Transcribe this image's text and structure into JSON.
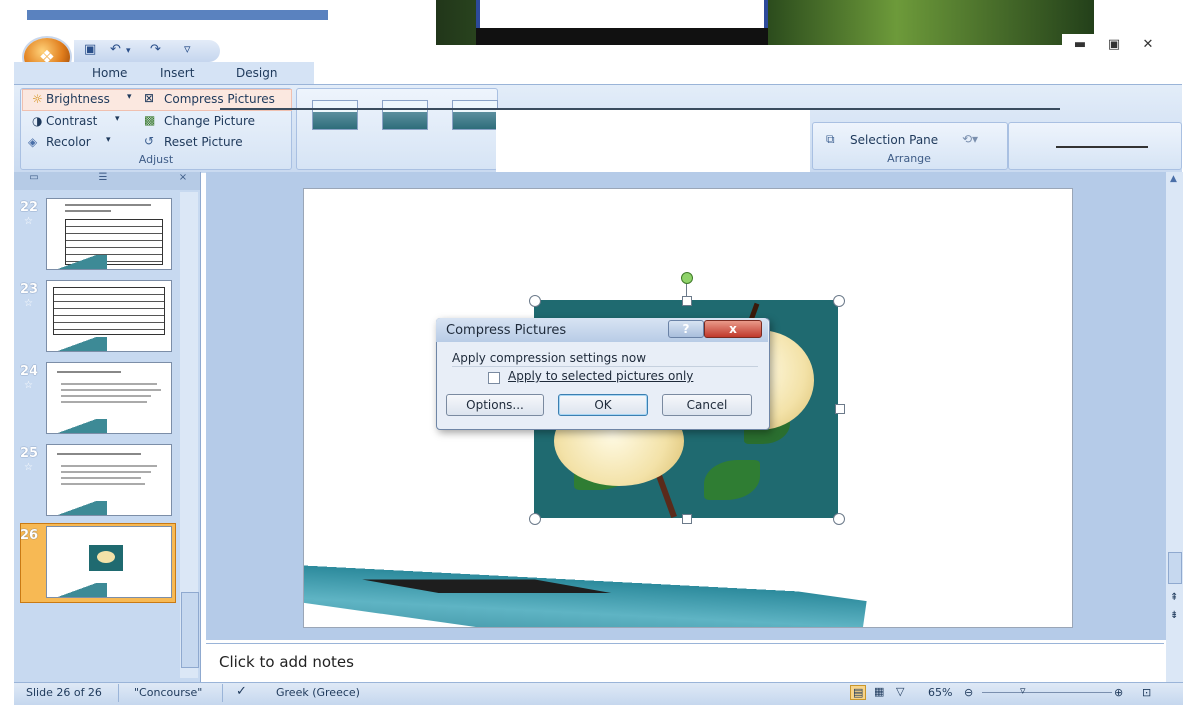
{
  "qat": {
    "save_icon": "save-icon",
    "undo_icon": "undo-icon",
    "redo_icon": "redo-icon",
    "more_icon": "customize-icon"
  },
  "tabs": [
    "Home",
    "Insert",
    "Design"
  ],
  "ribbon": {
    "adjust": {
      "brightness": "Brightness",
      "contrast": "Contrast",
      "recolor": "Recolor",
      "compress": "Compress Pictures",
      "change": "Change Picture",
      "reset": "Reset Picture",
      "group_label": "Adjust"
    },
    "arrange": {
      "selection_pane": "Selection Pane",
      "group_label": "Arrange"
    }
  },
  "slides": [
    {
      "number": "22"
    },
    {
      "number": "23"
    },
    {
      "number": "24"
    },
    {
      "number": "25"
    },
    {
      "number": "26"
    }
  ],
  "dialog": {
    "title": "Compress Pictures",
    "help": "?",
    "close": "x",
    "heading": "Apply compression settings now",
    "checkbox_label": "Apply to selected pictures only",
    "options": "Options...",
    "ok": "OK",
    "cancel": "Cancel"
  },
  "notes": {
    "placeholder": "Click to add notes"
  },
  "status": {
    "slide": "Slide 26 of 26",
    "theme": "\"Concourse\"",
    "language": "Greek (Greece)",
    "zoom": "65%"
  },
  "colors": {
    "accent": "#c5d7ee",
    "selected_thumb": "#f7b954",
    "dialog_close": "#c0392b"
  }
}
